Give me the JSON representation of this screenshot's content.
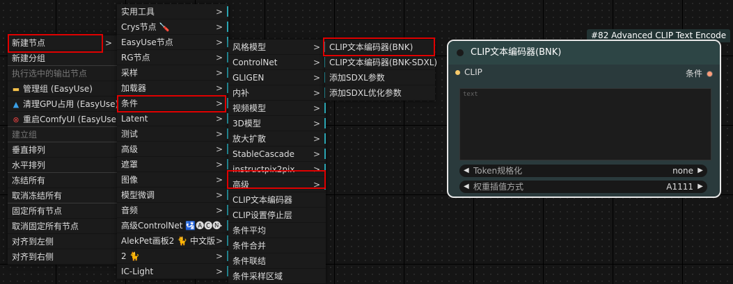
{
  "menu1": {
    "items": [
      {
        "label": "新建节点",
        "arrow": ">"
      },
      {
        "label": "新建分组"
      },
      {
        "label": "执行选中的输出节点",
        "disabled": true
      },
      {
        "label": "管理组 (EasyUse)",
        "icon": "folder-icon"
      },
      {
        "label": "清理GPU占用 (EasyUse)",
        "icon": "rocket-icon"
      },
      {
        "label": "重启ComfyUI (EasyUse)",
        "icon": "restart-icon"
      },
      {
        "label": "建立组",
        "disabled": true
      },
      {
        "label": "垂直排列"
      },
      {
        "label": "水平排列"
      },
      {
        "label": "冻结所有"
      },
      {
        "label": "取消冻结所有"
      },
      {
        "label": "固定所有节点"
      },
      {
        "label": "取消固定所有节点"
      },
      {
        "label": "对齐到左侧"
      },
      {
        "label": "对齐到右侧"
      }
    ]
  },
  "menu2": {
    "items": [
      {
        "label": "实用工具"
      },
      {
        "label": "Crys节点 🪛"
      },
      {
        "label": "EasyUse节点"
      },
      {
        "label": "RG节点"
      },
      {
        "label": "采样"
      },
      {
        "label": "加载器"
      },
      {
        "label": "条件"
      },
      {
        "label": "Latent"
      },
      {
        "label": "测试"
      },
      {
        "label": "高级"
      },
      {
        "label": "遮罩"
      },
      {
        "label": "图像"
      },
      {
        "label": "模型微调"
      },
      {
        "label": "音频"
      },
      {
        "label": "高级ControlNet 🛂🅐🅒🅝"
      },
      {
        "label": "AlekPet画板2 🐈 中文版"
      },
      {
        "label": "2 🐈"
      },
      {
        "label": "IC-Light"
      }
    ],
    "arrow": ">"
  },
  "menu3": {
    "items": [
      {
        "label": "风格模型",
        "arrow": ">"
      },
      {
        "label": "ControlNet",
        "arrow": ">"
      },
      {
        "label": "GLIGEN",
        "arrow": ">"
      },
      {
        "label": "内补",
        "arrow": ">"
      },
      {
        "label": "视频模型",
        "arrow": ">"
      },
      {
        "label": "3D模型",
        "arrow": ">"
      },
      {
        "label": "放大扩散",
        "arrow": ">"
      },
      {
        "label": "StableCascade",
        "arrow": ">"
      },
      {
        "label": "instructpix2pix",
        "arrow": ">"
      },
      {
        "label": "高级",
        "arrow": ">"
      },
      {
        "label": "CLIP文本编码器"
      },
      {
        "label": "CLIP设置停止层"
      },
      {
        "label": "条件平均"
      },
      {
        "label": "条件合并"
      },
      {
        "label": "条件联结"
      },
      {
        "label": "条件采样区域"
      }
    ]
  },
  "menu4": {
    "items": [
      {
        "label": "CLIP文本编码器(BNK)"
      },
      {
        "label": "CLIP文本编码器(BNK-SDXL)"
      },
      {
        "label": "添加SDXL参数"
      },
      {
        "label": "添加SDXL优化参数"
      }
    ]
  },
  "node": {
    "tag": "#82 Advanced CLIP Text Encode",
    "title": "CLIP文本编码器(BNK)",
    "input_label": "CLIP",
    "output_label": "条件",
    "text_placeholder": "text",
    "widgets": [
      {
        "name": "Token规格化",
        "value": "none",
        "left": "◀",
        "right": "▶"
      },
      {
        "name": "权重插值方式",
        "value": "A1111",
        "left": "◀",
        "right": "▶"
      }
    ],
    "colors": {
      "clip_pin": "#f7c96a",
      "cond_pin": "#ff9d7a",
      "accent": "#2aa6b3",
      "highlight": "#e00000"
    }
  }
}
